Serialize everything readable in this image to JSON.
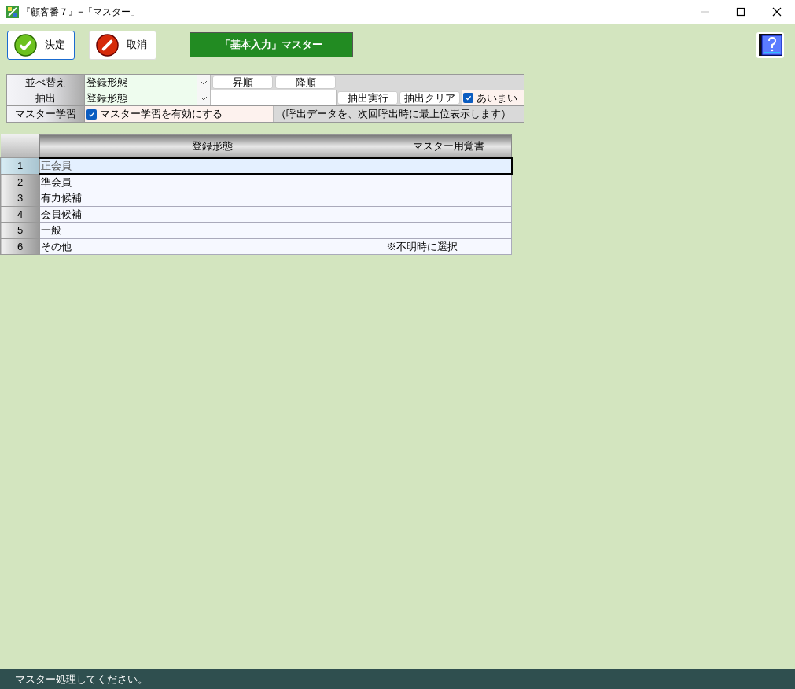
{
  "window": {
    "title": "『顧客番７』−「マスター」"
  },
  "toolbar": {
    "buttons": [
      {
        "kind": "ok",
        "label": "決定",
        "focused": true
      },
      {
        "kind": "cancel",
        "label": "取消",
        "focused": false
      }
    ],
    "banner": "「基本入力」マスター"
  },
  "sort": {
    "label": "並べ替え",
    "field": "登録形態",
    "buttons": [
      "昇順",
      "降順"
    ]
  },
  "filter": {
    "label": "抽出",
    "field": "登録形態",
    "buttons": [
      "抽出実行",
      "抽出クリア"
    ],
    "fuzzy": {
      "label": "あいまい",
      "checked": true
    }
  },
  "learning": {
    "label": "マスター学習",
    "option": {
      "label": "マスター学習を有効にする",
      "checked": true
    },
    "note": "（呼出データを、次回呼出時に最上位表示します）"
  },
  "table": {
    "columns": [
      "登録形態",
      "マスター用覚書"
    ],
    "rows": [
      {
        "number": "1",
        "cells": [
          "正会員",
          ""
        ],
        "selected": true
      },
      {
        "number": "2",
        "cells": [
          "準会員",
          ""
        ],
        "selected": false
      },
      {
        "number": "3",
        "cells": [
          "有力候補",
          ""
        ],
        "selected": false
      },
      {
        "number": "4",
        "cells": [
          "会員候補",
          ""
        ],
        "selected": false
      },
      {
        "number": "5",
        "cells": [
          "一般",
          ""
        ],
        "selected": false
      },
      {
        "number": "6",
        "cells": [
          "その他",
          "※不明時に選択"
        ],
        "selected": false
      }
    ]
  },
  "status_bar": "マスター処理してください。"
}
